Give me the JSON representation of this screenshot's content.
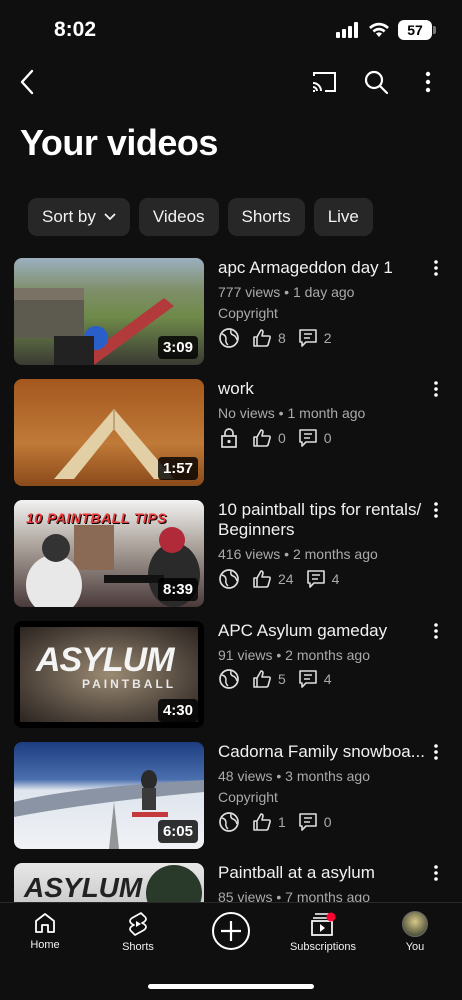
{
  "status_bar": {
    "time": "8:02",
    "battery": "57"
  },
  "header": {
    "title": "Your videos"
  },
  "chips": [
    {
      "label": "Sort by"
    },
    {
      "label": "Videos"
    },
    {
      "label": "Shorts"
    },
    {
      "label": "Live"
    }
  ],
  "videos": [
    {
      "title": "apc Armageddon day 1",
      "views": "777 views",
      "age": "1 day ago",
      "copyright": "Copyright",
      "visibility_icon": "globe-icon",
      "likes": "8",
      "comments": "2",
      "duration": "3:09",
      "thumb_colors": [
        "#6f8a4a",
        "#2c2a26"
      ]
    },
    {
      "title": "work",
      "views": "No views",
      "age": "1 month ago",
      "copyright": "",
      "visibility_icon": "lock-icon",
      "likes": "0",
      "comments": "0",
      "duration": "1:57",
      "thumb_colors": [
        "#b06a2a",
        "#d8c39a"
      ]
    },
    {
      "title": "10 paintball tips for rentals/ Beginners",
      "views": "416 views",
      "age": "2 months ago",
      "copyright": "",
      "visibility_icon": "globe-icon",
      "likes": "24",
      "comments": "4",
      "duration": "8:39",
      "thumb_colors": [
        "#8c8c86",
        "#3a2f3a"
      ],
      "thumb_text": "10 PAINTBALL TIPS"
    },
    {
      "title": "APC Asylum gameday",
      "views": "91 views",
      "age": "2 months ago",
      "copyright": "",
      "visibility_icon": "globe-icon",
      "likes": "5",
      "comments": "4",
      "duration": "4:30",
      "thumb_colors": [
        "#3a3530",
        "#8a7a66"
      ],
      "thumb_text": "ASYLUM",
      "thumb_subtext": "PAINTBALL"
    },
    {
      "title": "Cadorna Family snowboa...",
      "views": "48 views",
      "age": "3 months ago",
      "copyright": "Copyright",
      "visibility_icon": "globe-icon",
      "likes": "1",
      "comments": "0",
      "duration": "6:05",
      "thumb_colors": [
        "#2c4a86",
        "#e6eaf0"
      ]
    },
    {
      "title": "Paintball at a asylum",
      "views": "85 views",
      "age": "7 months ago",
      "copyright": "",
      "visibility_icon": "globe-icon",
      "likes": "",
      "comments": "",
      "duration": "",
      "thumb_colors": [
        "#cfcfcf",
        "#3a3a3a"
      ]
    }
  ],
  "bottom_nav": [
    {
      "label": "Home",
      "icon": "home-icon"
    },
    {
      "label": "Shorts",
      "icon": "shorts-icon"
    },
    {
      "label": "",
      "icon": "create-icon"
    },
    {
      "label": "Subscriptions",
      "icon": "subscriptions-icon"
    },
    {
      "label": "You",
      "icon": "avatar"
    }
  ]
}
